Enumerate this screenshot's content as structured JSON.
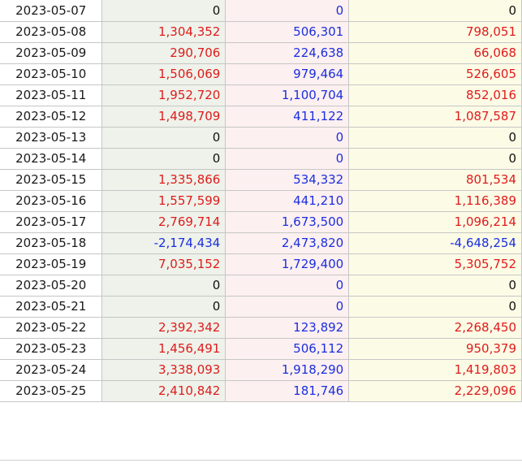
{
  "rows": [
    {
      "date": "2023-05-07",
      "a": "0",
      "b": "0",
      "c": "0",
      "a_sign": "zero",
      "c_sign": "zero"
    },
    {
      "date": "2023-05-08",
      "a": "1,304,352",
      "b": "506,301",
      "c": "798,051",
      "a_sign": "pos",
      "c_sign": "pos"
    },
    {
      "date": "2023-05-09",
      "a": "290,706",
      "b": "224,638",
      "c": "66,068",
      "a_sign": "pos",
      "c_sign": "pos"
    },
    {
      "date": "2023-05-10",
      "a": "1,506,069",
      "b": "979,464",
      "c": "526,605",
      "a_sign": "pos",
      "c_sign": "pos"
    },
    {
      "date": "2023-05-11",
      "a": "1,952,720",
      "b": "1,100,704",
      "c": "852,016",
      "a_sign": "pos",
      "c_sign": "pos"
    },
    {
      "date": "2023-05-12",
      "a": "1,498,709",
      "b": "411,122",
      "c": "1,087,587",
      "a_sign": "pos",
      "c_sign": "pos"
    },
    {
      "date": "2023-05-13",
      "a": "0",
      "b": "0",
      "c": "0",
      "a_sign": "zero",
      "c_sign": "zero"
    },
    {
      "date": "2023-05-14",
      "a": "0",
      "b": "0",
      "c": "0",
      "a_sign": "zero",
      "c_sign": "zero"
    },
    {
      "date": "2023-05-15",
      "a": "1,335,866",
      "b": "534,332",
      "c": "801,534",
      "a_sign": "pos",
      "c_sign": "pos"
    },
    {
      "date": "2023-05-16",
      "a": "1,557,599",
      "b": "441,210",
      "c": "1,116,389",
      "a_sign": "pos",
      "c_sign": "pos"
    },
    {
      "date": "2023-05-17",
      "a": "2,769,714",
      "b": "1,673,500",
      "c": "1,096,214",
      "a_sign": "pos",
      "c_sign": "pos"
    },
    {
      "date": "2023-05-18",
      "a": "-2,174,434",
      "b": "2,473,820",
      "c": "-4,648,254",
      "a_sign": "neg",
      "c_sign": "neg"
    },
    {
      "date": "2023-05-19",
      "a": "7,035,152",
      "b": "1,729,400",
      "c": "5,305,752",
      "a_sign": "pos",
      "c_sign": "pos"
    },
    {
      "date": "2023-05-20",
      "a": "0",
      "b": "0",
      "c": "0",
      "a_sign": "zero",
      "c_sign": "zero"
    },
    {
      "date": "2023-05-21",
      "a": "0",
      "b": "0",
      "c": "0",
      "a_sign": "zero",
      "c_sign": "zero"
    },
    {
      "date": "2023-05-22",
      "a": "2,392,342",
      "b": "123,892",
      "c": "2,268,450",
      "a_sign": "pos",
      "c_sign": "pos"
    },
    {
      "date": "2023-05-23",
      "a": "1,456,491",
      "b": "506,112",
      "c": "950,379",
      "a_sign": "pos",
      "c_sign": "pos"
    },
    {
      "date": "2023-05-24",
      "a": "3,338,093",
      "b": "1,918,290",
      "c": "1,419,803",
      "a_sign": "pos",
      "c_sign": "pos"
    },
    {
      "date": "2023-05-25",
      "a": "2,410,842",
      "b": "181,746",
      "c": "2,229,096",
      "a_sign": "pos",
      "c_sign": "pos"
    }
  ],
  "colors": {
    "positive": "#e01b1b",
    "negative": "#1b2ee0",
    "zero": "#111111",
    "col_a_bg": "#eef2ea",
    "col_b_bg": "#fdf0f0",
    "col_c_bg": "#fcfbe6"
  }
}
